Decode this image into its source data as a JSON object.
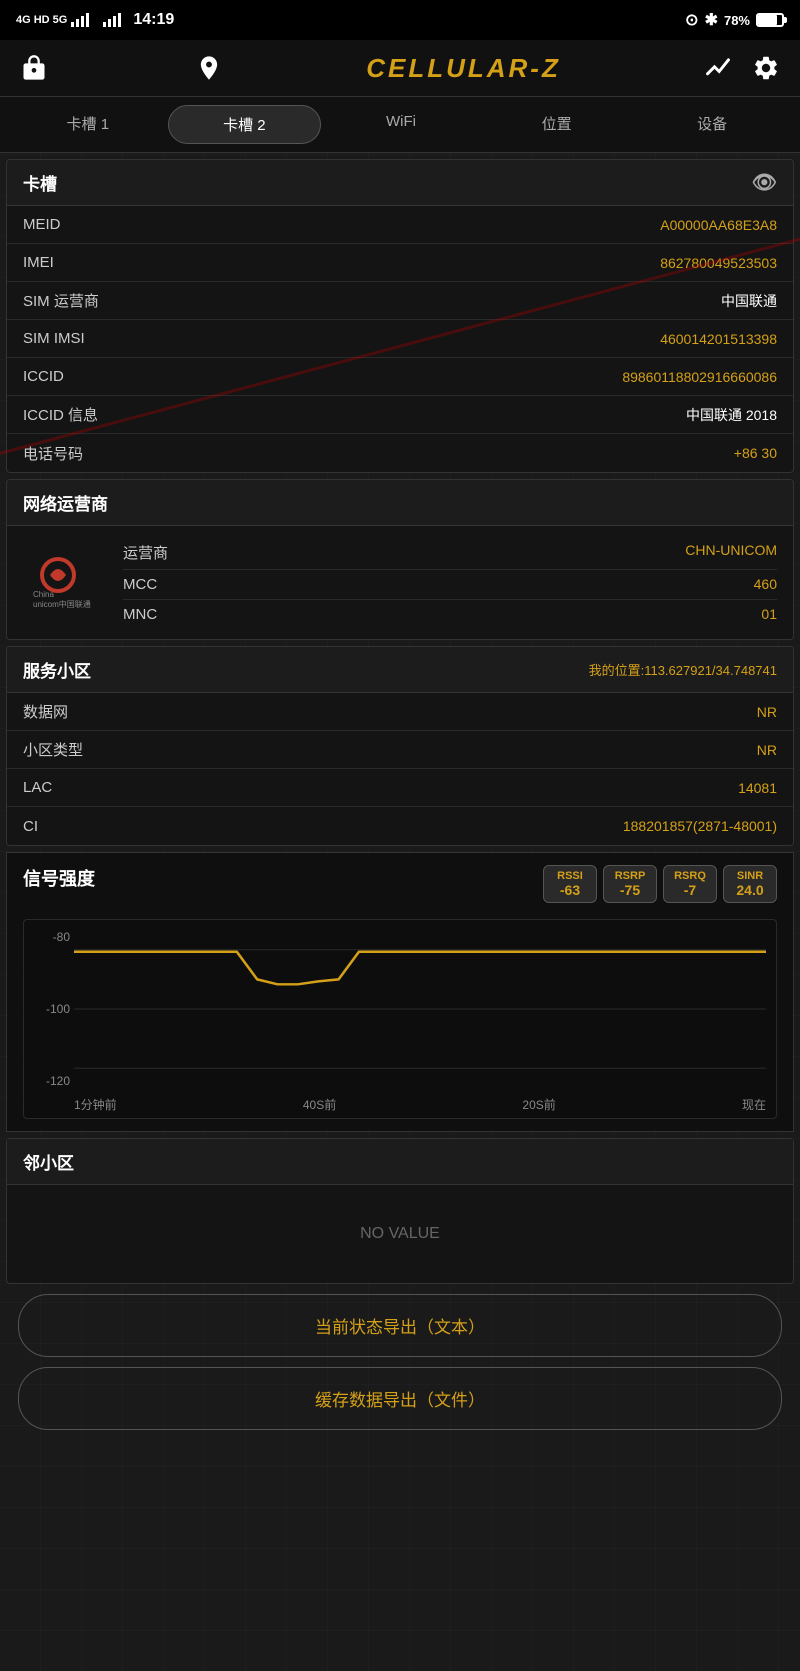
{
  "statusBar": {
    "network": "4G HD 5G",
    "time": "14:19",
    "location": "⊙",
    "bluetooth": "✱",
    "battery": "78%"
  },
  "header": {
    "title": "CELLULAR-Z",
    "lockIcon": "🔓",
    "personIcon": "👤",
    "chartIcon": "∧",
    "settingsIcon": "⚙"
  },
  "tabs": [
    {
      "id": "slot1",
      "label": "卡槽 1",
      "active": false
    },
    {
      "id": "slot2",
      "label": "卡槽 2",
      "active": true
    },
    {
      "id": "wifi",
      "label": "WiFi",
      "active": false
    },
    {
      "id": "location",
      "label": "位置",
      "active": false
    },
    {
      "id": "device",
      "label": "设备",
      "active": false
    }
  ],
  "simCard": {
    "sectionTitle": "卡槽",
    "rows": [
      {
        "label": "MEID",
        "value": "A00000AA68E3A8"
      },
      {
        "label": "IMEI",
        "value": "862780049523503"
      },
      {
        "label": "SIM 运营商",
        "value": "中国联通"
      },
      {
        "label": "SIM IMSI",
        "value": "460014201513398"
      },
      {
        "label": "ICCID",
        "value": "89860118802916660086"
      },
      {
        "label": "ICCID 信息",
        "value": "中国联通 2018"
      },
      {
        "label": "电话号码",
        "value": "+86          30"
      }
    ]
  },
  "networkOperator": {
    "sectionTitle": "网络运营商",
    "rows": [
      {
        "label": "运营商",
        "value": "CHN-UNICOM"
      },
      {
        "label": "MCC",
        "value": "460"
      },
      {
        "label": "MNC",
        "value": "01"
      }
    ]
  },
  "serviceCell": {
    "sectionTitle": "服务小区",
    "locationText": "我的位置:113.627921/34.748741",
    "rows": [
      {
        "label": "数据网",
        "value": "NR"
      },
      {
        "label": "小区类型",
        "value": "NR"
      },
      {
        "label": "LAC",
        "value": "14081"
      },
      {
        "label": "CI",
        "value": "188201857(2871-48001)"
      }
    ]
  },
  "signalStrength": {
    "title": "信号强度",
    "badges": [
      {
        "label": "RSSI",
        "value": "-63"
      },
      {
        "label": "RSRP",
        "value": "-75"
      },
      {
        "label": "RSRQ",
        "value": "-7"
      },
      {
        "label": "SINR",
        "value": "24.0"
      }
    ],
    "chart": {
      "yLabels": [
        "-80",
        "-100",
        "-120"
      ],
      "xLabels": [
        "1分钟前",
        "40S前",
        "20S前",
        "现在"
      ]
    }
  },
  "neighborCell": {
    "title": "邻小区",
    "noValueText": "NO VALUE"
  },
  "exportButtons": [
    {
      "id": "export-text",
      "label": "当前状态导出（文本）"
    },
    {
      "id": "export-file",
      "label": "缓存数据导出（文件）"
    }
  ]
}
